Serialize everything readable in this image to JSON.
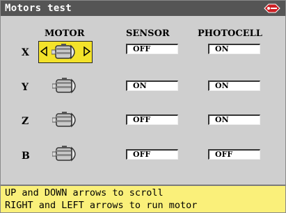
{
  "title": "Motors test",
  "columns": {
    "motor": "MOTOR",
    "sensor": "SENSOR",
    "photocell": "PHOTOCELL"
  },
  "rows": [
    {
      "axis": "X",
      "sensor": "OFF",
      "photocell": "ON",
      "selected": true
    },
    {
      "axis": "Y",
      "sensor": "ON",
      "photocell": "ON",
      "selected": false
    },
    {
      "axis": "Z",
      "sensor": "OFF",
      "photocell": "ON",
      "selected": false
    },
    {
      "axis": "B",
      "sensor": "OFF",
      "photocell": "OFF",
      "selected": false
    }
  ],
  "help": {
    "line1": "UP and DOWN arrows to scroll",
    "line2": "RIGHT and LEFT arrows to run motor"
  },
  "icons": {
    "brand": "brand-logo-icon",
    "motor": "motor-icon",
    "left": "triangle-left-icon",
    "right": "triangle-right-icon"
  },
  "colors": {
    "titlebar": "#555555",
    "highlight": "#f3e22a",
    "statusbar": "#faf07a",
    "background": "#cfcfcf",
    "brand": "#cc1f24"
  }
}
